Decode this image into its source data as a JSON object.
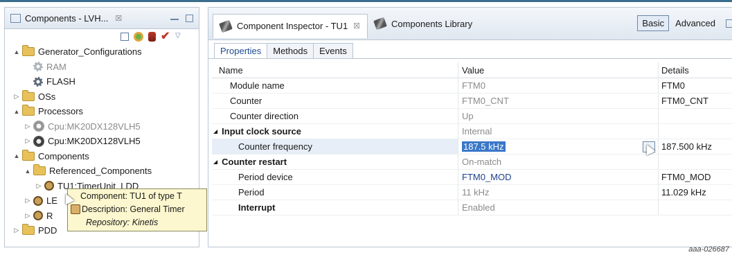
{
  "left_panel": {
    "tab_title": "Components - LVH...",
    "close_glyph": "☒",
    "tree": [
      {
        "label": "Generator_Configurations",
        "indent": 0,
        "icon": "folder-icon",
        "twisty": "▲",
        "dim": false
      },
      {
        "label": "RAM",
        "indent": 1,
        "icon": "gear-icon",
        "twisty": "",
        "dim": true
      },
      {
        "label": "FLASH",
        "indent": 1,
        "icon": "gear-icon",
        "twisty": "",
        "dim": false
      },
      {
        "label": "OSs",
        "indent": 0,
        "icon": "folder-icon",
        "twisty": "▷",
        "dim": false
      },
      {
        "label": "Processors",
        "indent": 0,
        "icon": "folder-icon",
        "twisty": "▲",
        "dim": false
      },
      {
        "label": "Cpu:MK20DX128VLH5",
        "indent": 1,
        "icon": "chip-icon",
        "twisty": "▷",
        "dim": true
      },
      {
        "label": "Cpu:MK20DX128VLH5",
        "indent": 1,
        "icon": "chip-icon",
        "twisty": "▷",
        "dim": false
      },
      {
        "label": "Components",
        "indent": 0,
        "icon": "folder-icon",
        "twisty": "▲",
        "dim": false
      },
      {
        "label": "Referenced_Components",
        "indent": 1,
        "icon": "folder-icon",
        "twisty": "▲",
        "dim": false
      },
      {
        "label": "TU1:TimerUnit_LDD",
        "indent": 2,
        "icon": "component-icon",
        "twisty": "▷",
        "dim": false
      },
      {
        "label": "LE",
        "indent": 1,
        "icon": "component-icon",
        "twisty": "▷",
        "dim": false
      },
      {
        "label": "R",
        "indent": 1,
        "icon": "component-icon",
        "twisty": "▷",
        "dim": false
      },
      {
        "label": "PDD",
        "indent": 0,
        "icon": "folder-icon",
        "twisty": "▷",
        "dim": false
      }
    ],
    "tooltip": {
      "line1": "Component: TU1 of type T",
      "line2": "Description: General Timer",
      "line3": "Repository: Kinetis"
    }
  },
  "right_panel": {
    "tabs": [
      {
        "label": "Component Inspector - TU1",
        "close": "☒"
      },
      {
        "label": "Components Library"
      }
    ],
    "mode_basic": "Basic",
    "mode_advanced": "Advanced",
    "subtabs": [
      "Properties",
      "Methods",
      "Events"
    ],
    "columns": [
      "Name",
      "Value",
      "Details"
    ],
    "rows": [
      {
        "name": "Module name",
        "value": "FTM0",
        "details": "FTM0",
        "indent": 1,
        "bold": false,
        "twisty": "",
        "vstyle": "grey"
      },
      {
        "name": "Counter",
        "value": "FTM0_CNT",
        "details": "FTM0_CNT",
        "indent": 1,
        "bold": false,
        "twisty": "",
        "vstyle": "grey"
      },
      {
        "name": "Counter direction",
        "value": "Up",
        "details": "",
        "indent": 1,
        "bold": false,
        "twisty": "",
        "vstyle": "grey"
      },
      {
        "name": "Input clock source",
        "value": "Internal",
        "details": "",
        "indent": 0,
        "bold": true,
        "twisty": "◢",
        "vstyle": "grey"
      },
      {
        "name": "Counter frequency",
        "value": "187.5 kHz",
        "details": "187.500 kHz",
        "indent": 2,
        "bold": false,
        "twisty": "",
        "vstyle": "selected"
      },
      {
        "name": "Counter restart",
        "value": "On-match",
        "details": "",
        "indent": 0,
        "bold": true,
        "twisty": "◢",
        "vstyle": "grey"
      },
      {
        "name": "Period device",
        "value": "FTM0_MOD",
        "details": "FTM0_MOD",
        "indent": 2,
        "bold": false,
        "twisty": "",
        "vstyle": "blue"
      },
      {
        "name": "Period",
        "value": "11 kHz",
        "details": "11.029 kHz",
        "indent": 2,
        "bold": false,
        "twisty": "",
        "vstyle": "grey"
      },
      {
        "name": "Interrupt",
        "value": "Enabled",
        "details": "",
        "indent": 2,
        "bold": true,
        "twisty": "",
        "vstyle": "grey"
      }
    ]
  },
  "caption": "aaa-026687"
}
